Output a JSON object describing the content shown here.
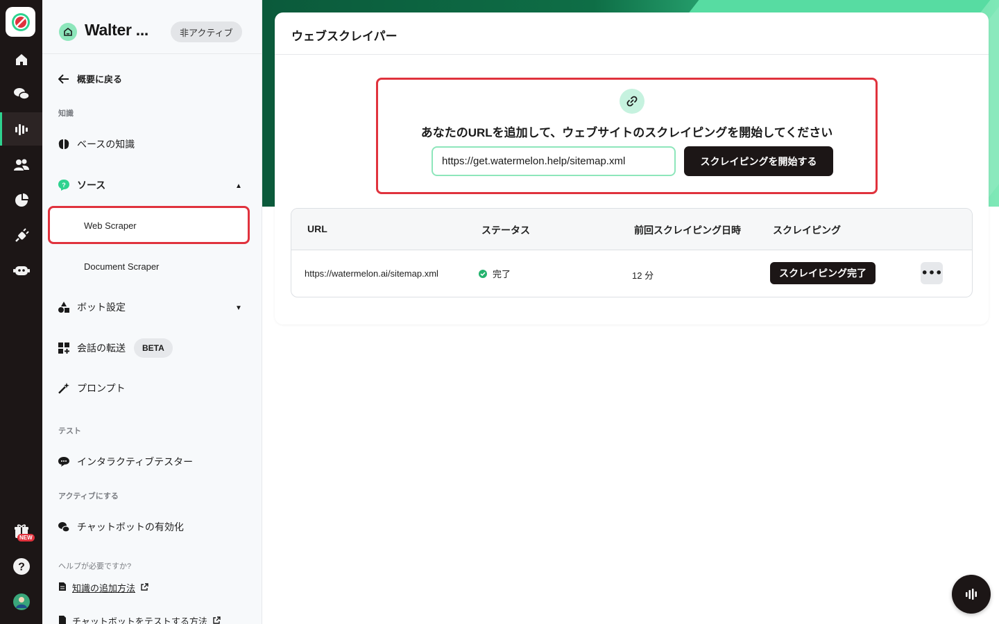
{
  "app": {
    "name": "Watermelon"
  },
  "colors": {
    "accent": "#2ed28f",
    "highlight": "#e0323d",
    "dark": "#1c1616"
  },
  "rail": {
    "items": [
      {
        "name": "home-icon"
      },
      {
        "name": "conversations-icon"
      },
      {
        "name": "bot-training-icon",
        "active": true
      },
      {
        "name": "contacts-icon"
      },
      {
        "name": "analytics-icon"
      },
      {
        "name": "integrations-icon"
      },
      {
        "name": "bots-icon"
      }
    ],
    "gift_badge": "NEW",
    "help_icon": "?"
  },
  "sidebar": {
    "bot_name": "Walter ...",
    "status": "非アクティブ",
    "back": "概要に戻る",
    "section_knowledge": "知識",
    "base_knowledge": "ベースの知識",
    "sources": "ソース",
    "web_scraper": "Web Scraper",
    "document_scraper": "Document Scraper",
    "bot_settings": "ボット設定",
    "conversation_transfer": "会話の転送",
    "beta": "BETA",
    "prompt": "プロンプト",
    "section_test": "テスト",
    "interactive_tester": "インタラクティブテスター",
    "section_activate": "アクティブにする",
    "enable_chatbot": "チャットボットの有効化",
    "section_help": "ヘルプが必要ですか?",
    "help_link_1": "知識の追加方法",
    "help_link_2": "チャットボットをテストする方法"
  },
  "main": {
    "title": "ウェブスクレイパー",
    "add_heading": "あなたのURLを追加して、ウェブサイトのスクレイピングを開始してください",
    "url_value": "https://get.watermelon.help/sitemap.xml",
    "start_button": "スクレイピングを開始する",
    "table": {
      "headers": [
        "URL",
        "ステータス",
        "前回スクレイピング日時",
        "スクレイピング"
      ],
      "rows": [
        {
          "url": "https://watermelon.ai/sitemap.xml",
          "status": "完了",
          "last": "12 分",
          "action": "スクレイピング完了",
          "more": "•••"
        }
      ]
    }
  }
}
